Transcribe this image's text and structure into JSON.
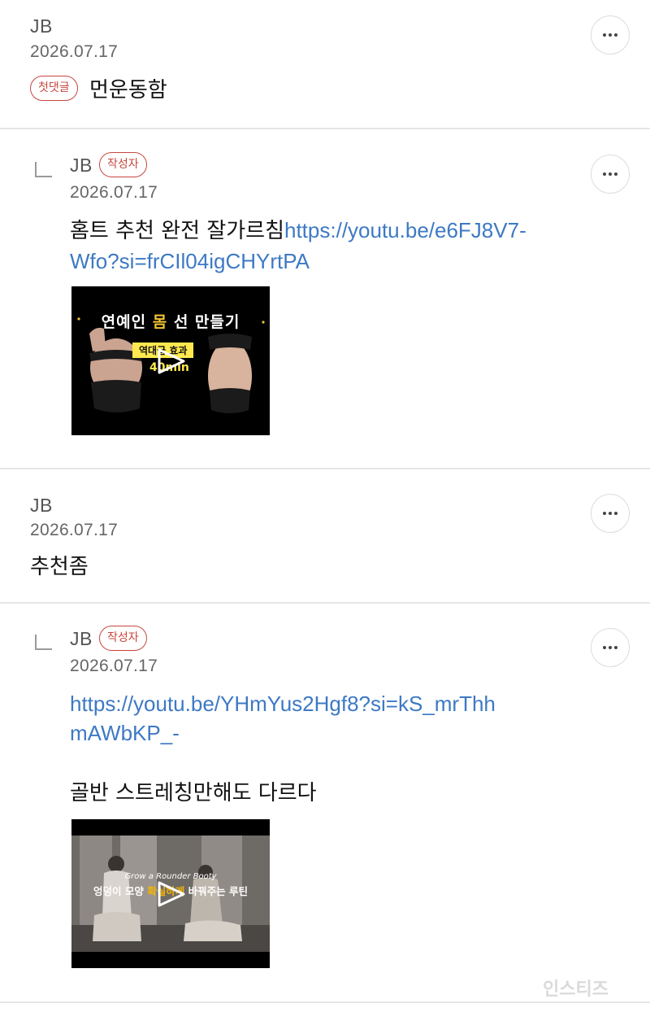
{
  "comments": [
    {
      "author": "JB",
      "date": "2026.07.17",
      "badge": "첫댓글",
      "text": "먼운동함"
    },
    {
      "author": "JB",
      "date": "2026.07.17",
      "badge": "작성자",
      "text": "홈트 추천 완전 잘가르침",
      "link_line1": "https://youtu.be/e6FJ8V7-",
      "link_line2": "Wfo?si=frCIl04igCHYrtPA",
      "thumbnail": {
        "title_a": "연예인",
        "title_b": "몸",
        "title_c": "선 만들기",
        "subtitle": "역대급 효과",
        "duration": "40min"
      }
    },
    {
      "author": "JB",
      "date": "2026.07.17",
      "text": "추천좀"
    },
    {
      "author": "JB",
      "date": "2026.07.17",
      "badge": "작성자",
      "link_line1": "https://youtu.be/YHmYus2Hgf8?si=kS_mrThh",
      "link_line2": "mAWbKP_-",
      "text": "골반 스트레칭만해도 다르다",
      "thumbnail": {
        "subtitle": "Grow a Rounder Booty",
        "title_a": "엉덩이 모양",
        "title_b": "확실하게",
        "title_c": "바꿔주는 루틴"
      }
    }
  ],
  "watermark": "인스티즈",
  "colors": {
    "link": "#3d79c4",
    "badge": "#c8473f",
    "divider": "#e6e6e6"
  },
  "icons": [
    "more-dots-icon",
    "reply-arrow-icon",
    "play-icon"
  ]
}
